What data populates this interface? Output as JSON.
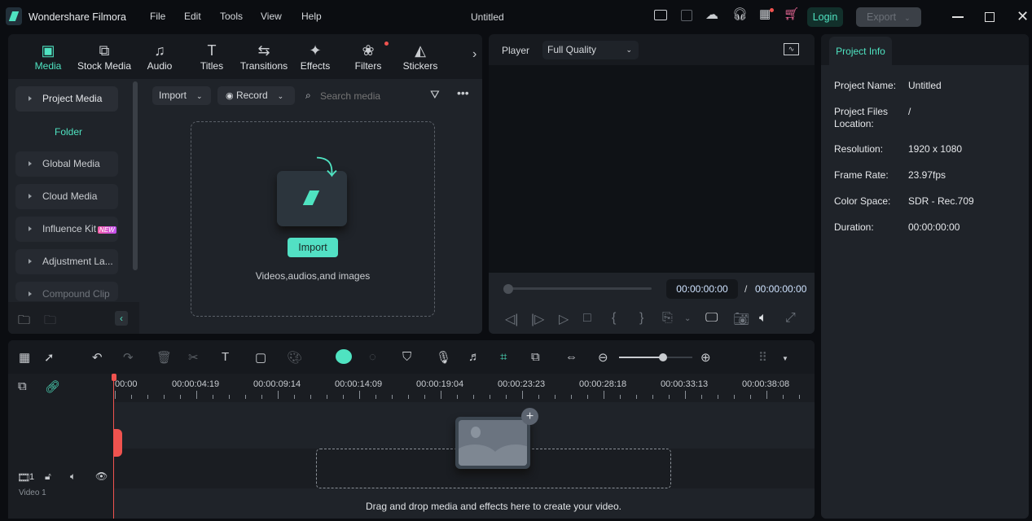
{
  "app": {
    "title": "Wondershare Filmora",
    "document": "Untitled",
    "login": "Login",
    "export": "Export"
  },
  "menu": [
    "File",
    "Edit",
    "Tools",
    "View",
    "Help"
  ],
  "titlebar_icons": [
    "layout-icon",
    "save-icon",
    "cloud-icon",
    "headset-icon",
    "apps-icon",
    "cart-icon"
  ],
  "tabs": [
    {
      "label": "Media",
      "icon": "media-icon",
      "active": true
    },
    {
      "label": "Stock Media",
      "icon": "stock-media-icon"
    },
    {
      "label": "Audio",
      "icon": "music-icon"
    },
    {
      "label": "Titles",
      "icon": "titles-icon"
    },
    {
      "label": "Transitions",
      "icon": "transitions-icon"
    },
    {
      "label": "Effects",
      "icon": "effects-icon"
    },
    {
      "label": "Filters",
      "icon": "filters-icon"
    },
    {
      "label": "Stickers",
      "icon": "stickers-icon"
    }
  ],
  "sidebar": {
    "project_media": "Project Media",
    "folder": "Folder",
    "items": [
      "Global Media",
      "Cloud Media",
      "Influence Kit",
      "Adjustment La...",
      "Compound Clip"
    ],
    "new_badge": "NEW"
  },
  "media_toolbar": {
    "import": "Import",
    "record": "Record",
    "search_placeholder": "Search media"
  },
  "dropzone": {
    "button": "Import",
    "hint": "Videos,audios,and images"
  },
  "player": {
    "label": "Player",
    "quality": "Full Quality",
    "current": "00:00:00:00",
    "separator": "/",
    "total": "00:00:00:00",
    "progress": 0
  },
  "project_info": {
    "tab": "Project Info",
    "rows": [
      {
        "label": "Project Name:",
        "value": "Untitled"
      },
      {
        "label": "Project Files Location:",
        "value": "/"
      },
      {
        "label": "Resolution:",
        "value": "1920 x 1080"
      },
      {
        "label": "Frame Rate:",
        "value": "23.97fps"
      },
      {
        "label": "Color Space:",
        "value": "SDR - Rec.709"
      },
      {
        "label": "Duration:",
        "value": "00:00:00:00"
      }
    ]
  },
  "timeline": {
    "ruler": [
      "00:00",
      "00:00:04:19",
      "00:00:09:14",
      "00:00:14:09",
      "00:00:19:04",
      "00:00:23:23",
      "00:00:28:18",
      "00:00:33:13",
      "00:00:38:08"
    ],
    "track": "Video 1",
    "track_num": "1",
    "hint": "Drag and drop media and effects here to create your video.",
    "zoom_level": 0.75
  },
  "colors": {
    "accent": "#4fe3c1",
    "bg": "#0b0d11",
    "panel": "#1f2329",
    "playhead": "#f0534f"
  }
}
